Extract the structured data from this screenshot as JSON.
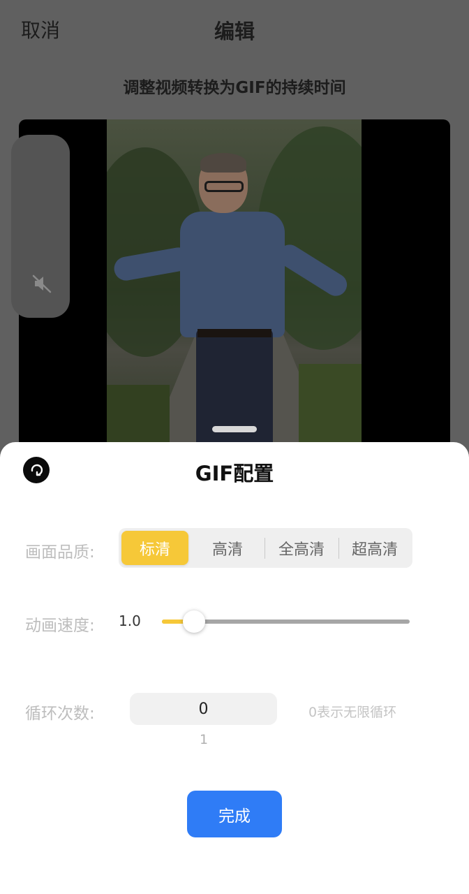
{
  "header": {
    "cancel_label": "取消",
    "title": "编辑",
    "subtitle": "调整视频转换为GIF的持续时间"
  },
  "video": {
    "mute_icon": "speaker-muted-icon"
  },
  "sheet": {
    "title": "GIF配置",
    "back_icon": "undo-arrow-icon",
    "quality": {
      "label": "画面品质:",
      "options": [
        "标清",
        "高清",
        "全高清",
        "超高清"
      ],
      "selected": "标清"
    },
    "speed": {
      "label": "动画速度:",
      "value": "1.0",
      "slider_fraction": 0.13
    },
    "loop": {
      "label": "循环次数:",
      "value": "0",
      "next_value": "1",
      "hint": "0表示无限循环"
    },
    "done_label": "完成"
  },
  "colors": {
    "accent_yellow": "#f6c838",
    "primary_blue": "#2f7cf6",
    "overlay": "#606060"
  }
}
